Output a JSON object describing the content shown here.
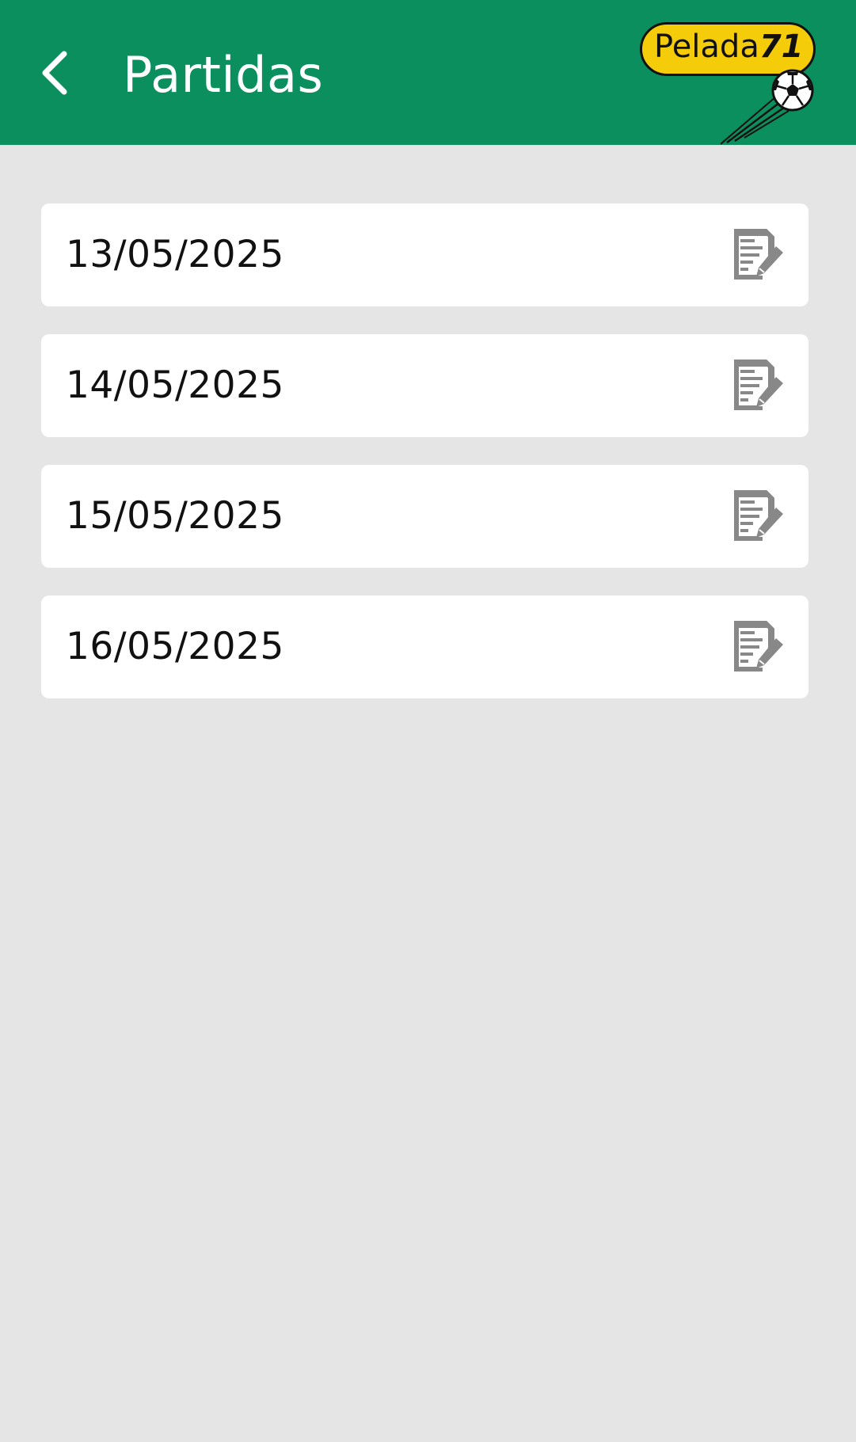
{
  "header": {
    "title": "Partidas",
    "back_icon": "chevron-left-icon",
    "background_color": "#0c8f5e"
  },
  "logo": {
    "text": "Pelada",
    "number": "71",
    "pill_color": "#f5cc0a"
  },
  "matches": [
    {
      "date": "13/05/2025",
      "action_icon": "edit-document-icon"
    },
    {
      "date": "14/05/2025",
      "action_icon": "edit-document-icon"
    },
    {
      "date": "15/05/2025",
      "action_icon": "edit-document-icon"
    },
    {
      "date": "16/05/2025",
      "action_icon": "edit-document-icon"
    }
  ],
  "colors": {
    "background": "#e5e5e5",
    "card": "#ffffff",
    "icon": "#888888"
  }
}
